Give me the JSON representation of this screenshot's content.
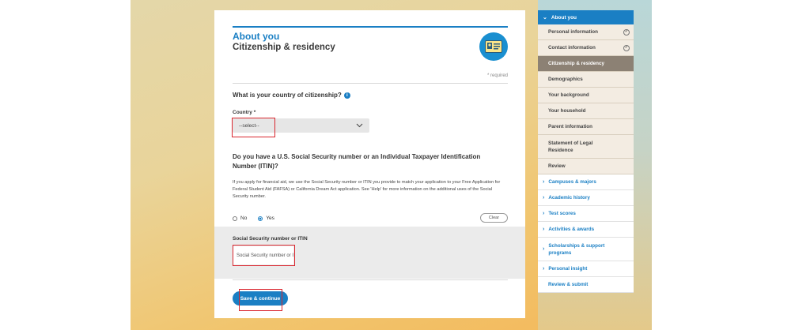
{
  "page": {
    "section_title": "About you",
    "heading": "Citizenship & residency",
    "required_note": "* required",
    "country_question": "What is your country of citizenship?",
    "country_label": "Country *",
    "country_select_value": "--select--",
    "ssn_question": "Do you have a U.S. Social Security number or an Individual Taxpayer Identification Number (ITIN)?",
    "ssn_help": "If you apply for financial aid, we use the Social Security number or ITIN you provide to match your application to your Free Application for Federal Student Aid (FAFSA) or California Dream Act application. See 'Help' for more information on the additional uses of the Social Security number.",
    "radio_no": "No",
    "radio_yes": "Yes",
    "clear_label": "Clear",
    "ssn_field_label": "Social Security number or ITIN",
    "ssn_placeholder": "Social Security number or ITIN",
    "save_label": "Save & continue"
  },
  "sidebar": {
    "header": "About you",
    "subitems": [
      {
        "label": "Personal information",
        "done": true
      },
      {
        "label": "Contact information",
        "done": true
      },
      {
        "label": "Citizenship & residency",
        "active": true
      },
      {
        "label": "Demographics"
      },
      {
        "label": "Your background"
      },
      {
        "label": "Your household"
      },
      {
        "label": "Parent information"
      },
      {
        "label": "Statement of Legal Residence"
      },
      {
        "label": "Review"
      }
    ],
    "sections": [
      "Campuses & majors",
      "Academic history",
      "Test scores",
      "Activities & awards",
      "Scholarships & support programs",
      "Personal insight",
      "Review & submit"
    ]
  },
  "colors": {
    "accent": "#1a7fc4",
    "highlight": "#d9262e",
    "active_nav": "#8c8174"
  }
}
